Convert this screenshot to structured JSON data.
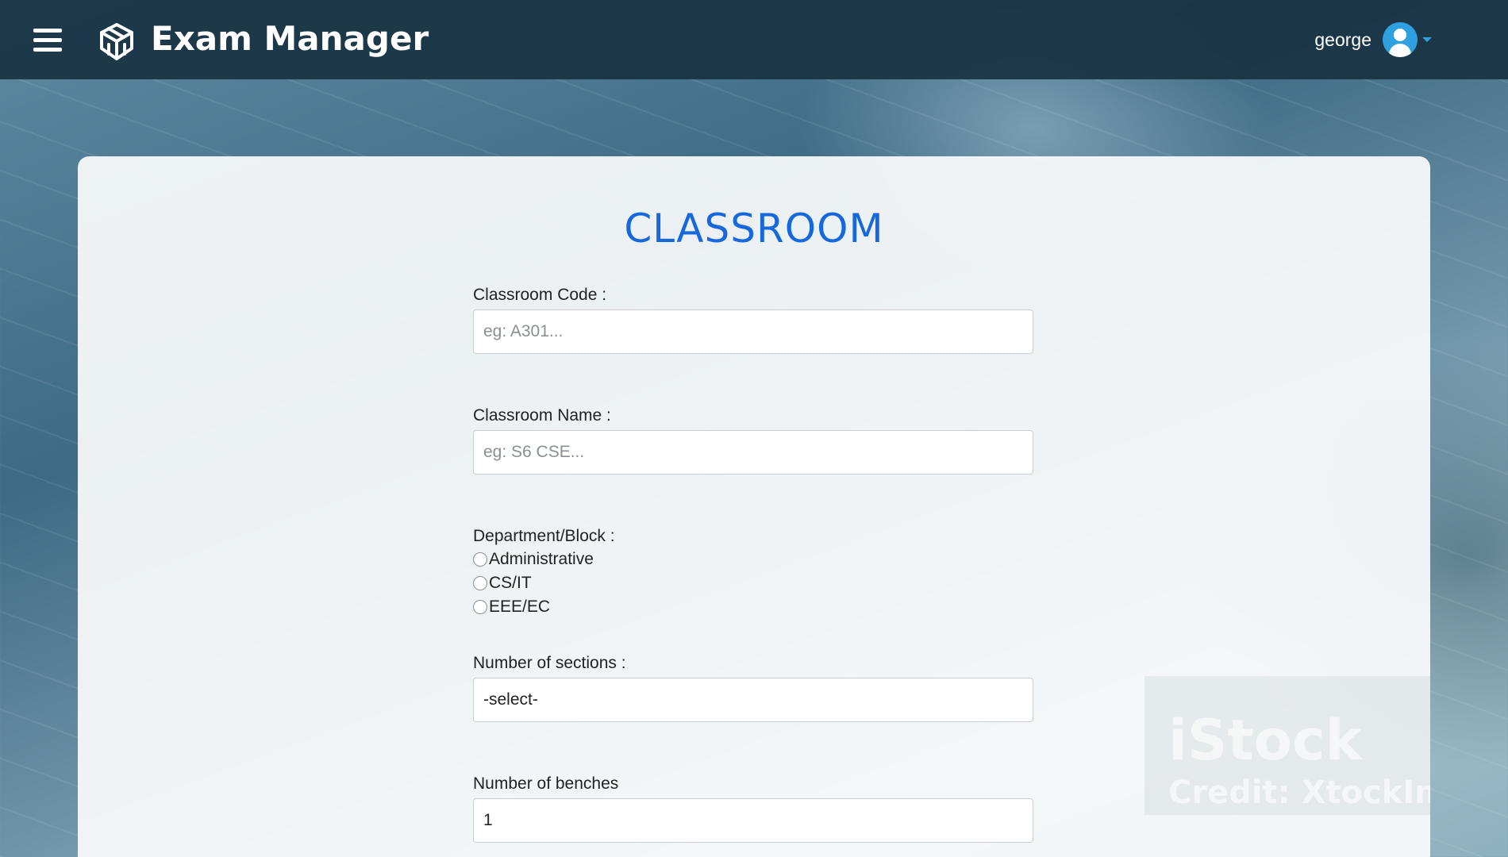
{
  "header": {
    "app_title": "Exam Manager",
    "username": "george",
    "menu_icon": "hamburger-menu-icon",
    "logo_icon": "cube-logo-icon",
    "avatar_icon": "user-avatar-icon"
  },
  "form": {
    "title": "CLASSROOM",
    "classroom_code": {
      "label": "Classroom Code :",
      "placeholder": "eg: A301..."
    },
    "classroom_name": {
      "label": "Classroom Name :",
      "placeholder": "eg: S6 CSE..."
    },
    "department": {
      "label": "Department/Block :",
      "options": [
        "Administrative",
        "CS/IT",
        "EEE/EC"
      ]
    },
    "sections": {
      "label": "Number of sections :",
      "selected": "-select-"
    },
    "benches": {
      "label": "Number of benches",
      "value": "1"
    }
  },
  "watermark": {
    "brand": "iStock",
    "credit": "Credit: XtockIm"
  },
  "colors": {
    "accent": "#1668dc",
    "header_bg": "#183242",
    "avatar": "#2fa0e0"
  }
}
